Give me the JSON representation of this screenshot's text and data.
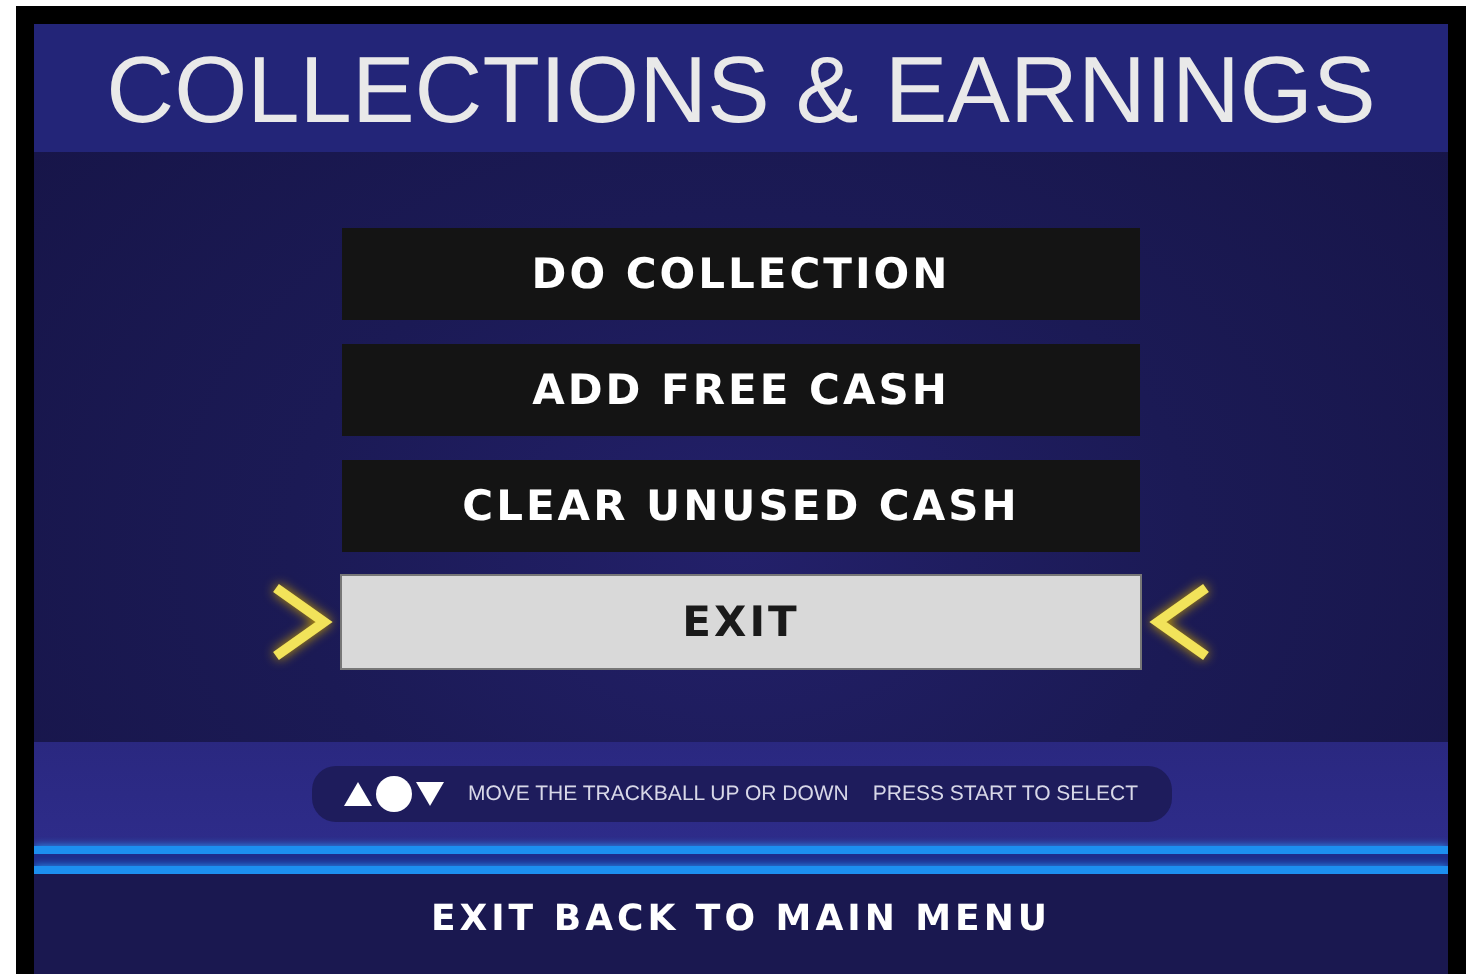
{
  "title": "COLLECTIONS & EARNINGS",
  "menu": [
    {
      "label": "DO COLLECTION",
      "selected": false
    },
    {
      "label": "ADD FREE CASH",
      "selected": false
    },
    {
      "label": "CLEAR UNUSED CASH",
      "selected": false
    },
    {
      "label": "EXIT",
      "selected": true
    }
  ],
  "hints": [
    "MOVE THE TRACKBALL UP OR DOWN",
    "PRESS START TO SELECT"
  ],
  "footer": "EXIT BACK TO MAIN MENU"
}
